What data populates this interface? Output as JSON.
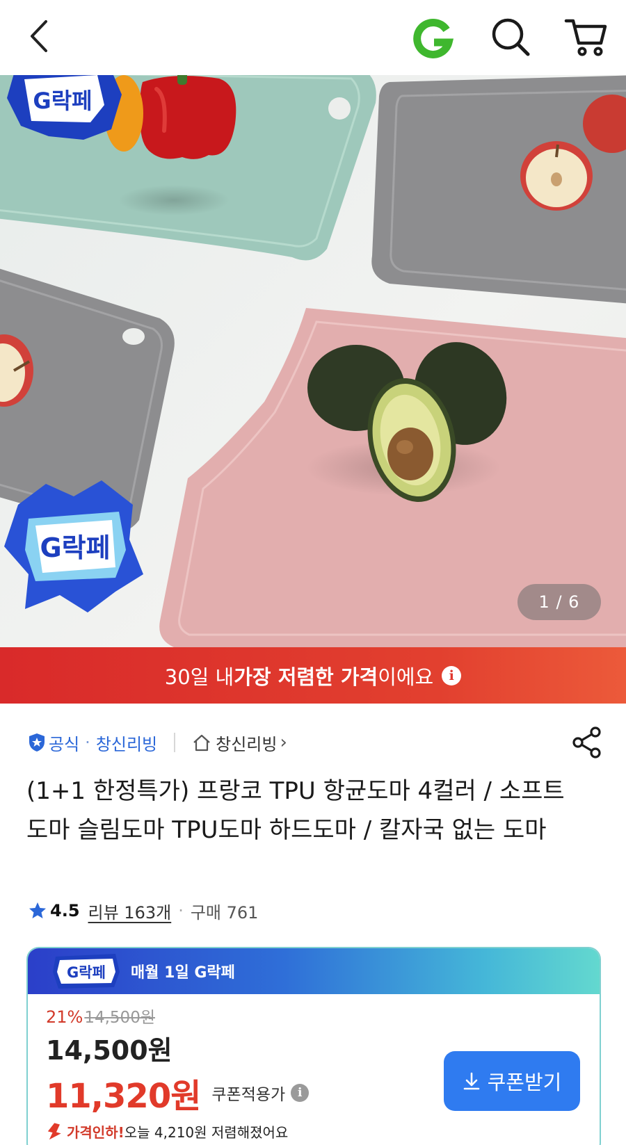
{
  "header": {
    "back_icon": "chevron-left-icon",
    "logo_text": "G",
    "logo_color": "#3fb72e",
    "search_icon": "search-icon",
    "cart_icon": "cart-icon"
  },
  "gallery": {
    "pager": "1 / 6",
    "badge_text": "G락페"
  },
  "lowest_banner": {
    "prefix": "30일 내 ",
    "bold": "가장 저렴한 가격",
    "suffix": "이에요",
    "info_glyph": "i",
    "color": "#e0352c"
  },
  "seller": {
    "official_label": "공식",
    "separator": "·",
    "seller_name": "창신리빙",
    "store_link": "창신리빙",
    "store_chevron": "›",
    "accent": "#2b67d8"
  },
  "product": {
    "title": "(1+1 한정특가) 프랑코 TPU 항균도마 4컬러 / 소프트도마 슬림도마 TPU도마 하드도마 / 칼자국 없는 도마"
  },
  "rating": {
    "score": "4.5",
    "reviews": "리뷰 163개",
    "separator": "·",
    "purchases": "구매 761"
  },
  "promo": {
    "badge_text": "G락페",
    "header_text": "매월 1일 G락페",
    "discount_rate": "21%",
    "original_price": "14,500원",
    "list_price": "14,500원",
    "sale_price": "11,320원",
    "coupon_label": "쿠폰적용가",
    "info_glyph": "i",
    "drop_red": "가격인하!",
    "drop_text": " 오늘 4,210원 저렴해졌어요",
    "coupon_button": "쿠폰받기",
    "button_color": "#2f7bf0"
  }
}
